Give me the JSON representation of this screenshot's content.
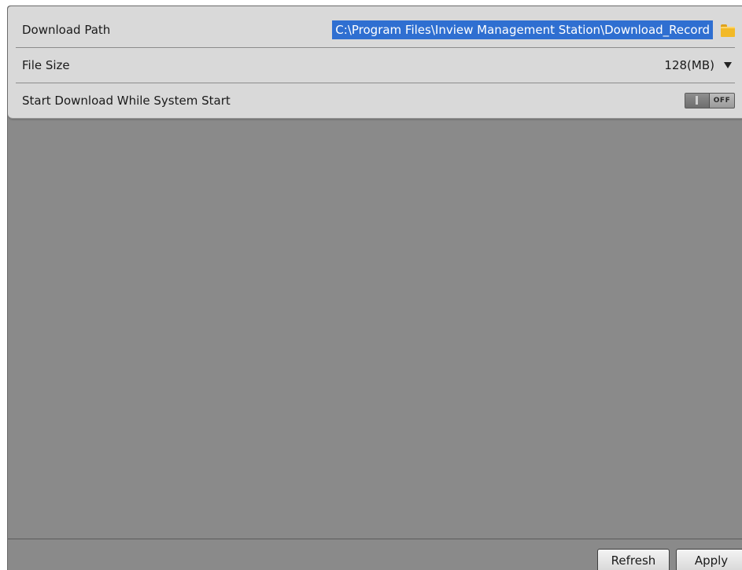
{
  "settings": {
    "download_path": {
      "label": "Download Path",
      "value": "C:\\Program Files\\Inview Management Station\\Download_Record",
      "icon": "folder-icon"
    },
    "file_size": {
      "label": "File Size",
      "value": "128(MB)",
      "icon": "dropdown-arrow-icon"
    },
    "start_download": {
      "label": "Start Download While System Start",
      "toggle_state": "OFF"
    }
  },
  "buttons": {
    "refresh": "Refresh",
    "apply": "Apply"
  },
  "colors": {
    "selection": "#2f6fd1",
    "panel": "#d9d9d9",
    "background": "#8a8a8a",
    "folder": "#f2b927"
  }
}
